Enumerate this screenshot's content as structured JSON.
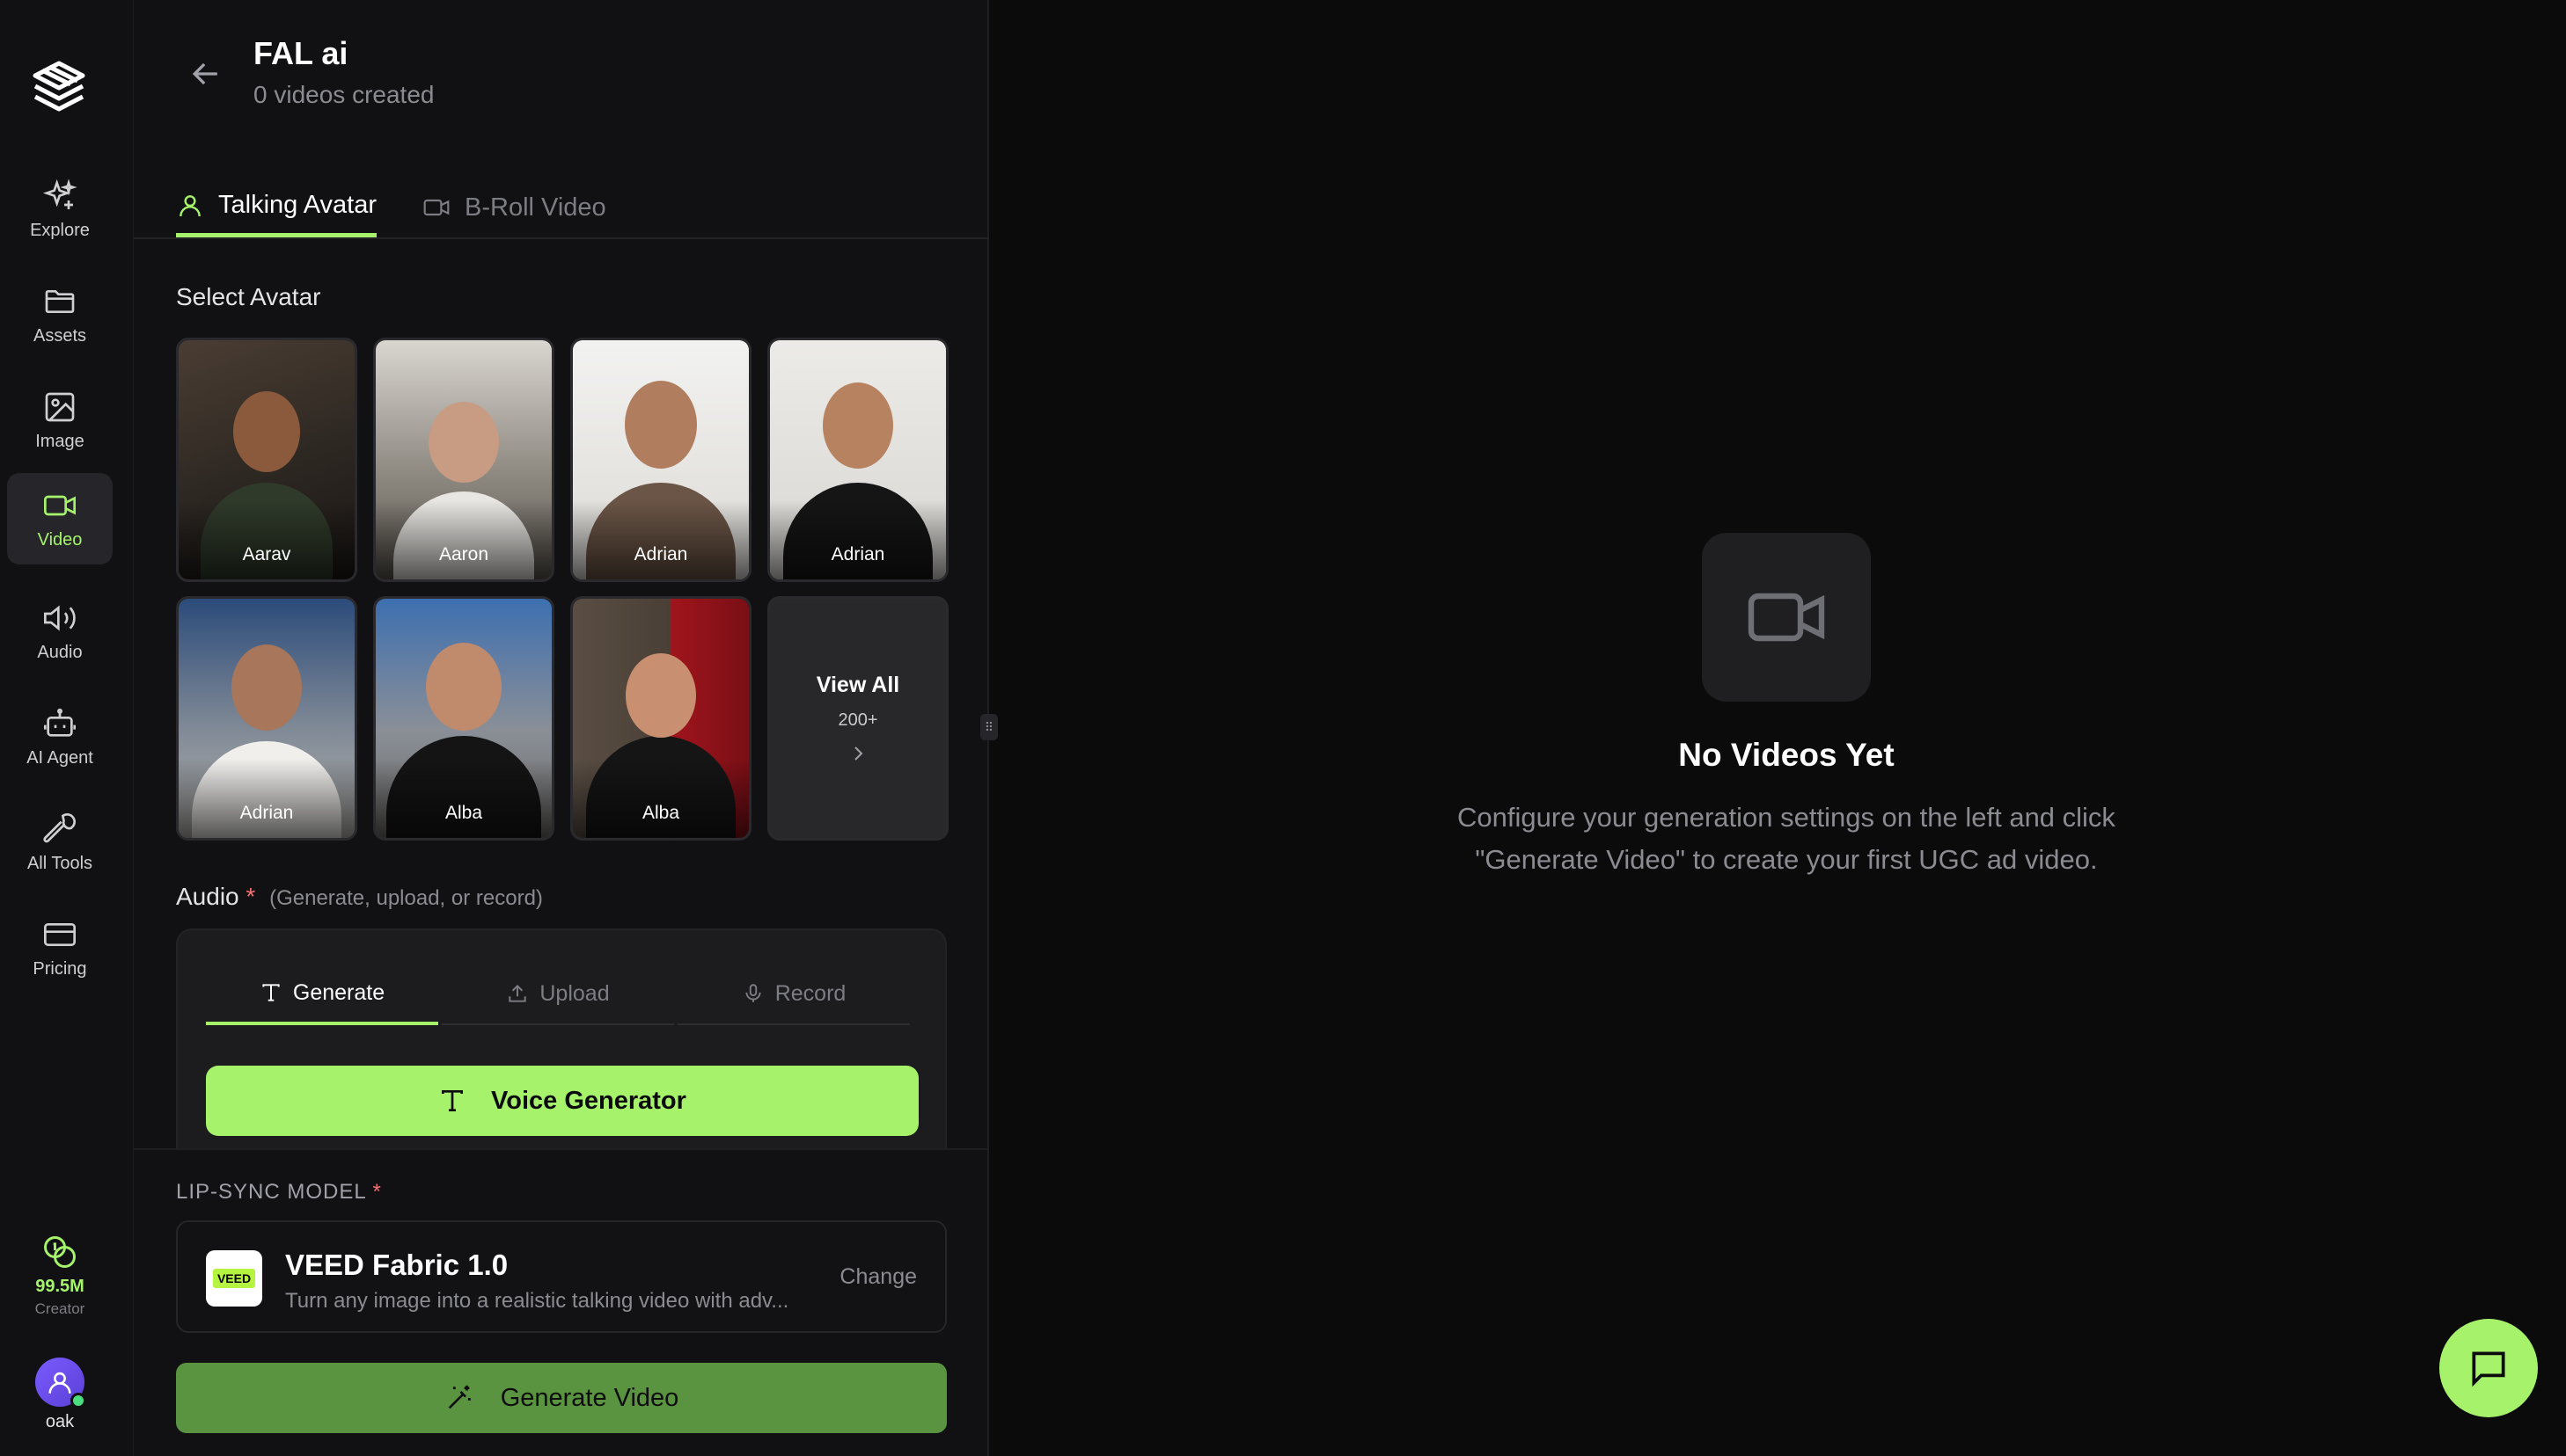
{
  "nav": {
    "items": [
      {
        "label": "Explore",
        "icon": "sparkles-icon"
      },
      {
        "label": "Assets",
        "icon": "folder-icon"
      },
      {
        "label": "Image",
        "icon": "image-icon"
      },
      {
        "label": "Video",
        "icon": "video-icon",
        "active": true
      },
      {
        "label": "Audio",
        "icon": "speaker-icon"
      },
      {
        "label": "AI Agent",
        "icon": "robot-icon"
      },
      {
        "label": "All Tools",
        "icon": "wrench-icon"
      },
      {
        "label": "Pricing",
        "icon": "credit-card-icon"
      }
    ],
    "credits": {
      "amount": "99.5M",
      "tier": "Creator"
    },
    "user": {
      "name": "oak"
    }
  },
  "project": {
    "title": "FAL ai",
    "subtitle": "0 videos created"
  },
  "tabs": {
    "talking_avatar": "Talking Avatar",
    "broll": "B-Roll Video"
  },
  "avatars": {
    "label": "Select Avatar",
    "items": [
      {
        "name": "Aarav"
      },
      {
        "name": "Aaron"
      },
      {
        "name": "Adrian"
      },
      {
        "name": "Adrian"
      },
      {
        "name": "Adrian"
      },
      {
        "name": "Alba"
      },
      {
        "name": "Alba"
      }
    ],
    "view_all": "View All",
    "view_all_count": "200+"
  },
  "audio": {
    "label": "Audio",
    "required_mark": "*",
    "hint": "(Generate, upload, or record)",
    "tabs": {
      "generate": "Generate",
      "upload": "Upload",
      "record": "Record"
    },
    "voice_button": "Voice Generator"
  },
  "lipsync": {
    "label": "LIP-SYNC MODEL",
    "required_mark": "*",
    "logo_text": "VEED",
    "model_name": "VEED Fabric 1.0",
    "model_desc": "Turn any image into a realistic talking video with adv...",
    "change": "Change"
  },
  "generate_button": "Generate Video",
  "empty_state": {
    "title": "No Videos Yet",
    "description": "Configure your generation settings on the left and click \"Generate Video\" to create your first UGC ad video."
  },
  "colors": {
    "accent": "#a6f36b",
    "generate_button": "#5a9440",
    "background": "#0b0b0c",
    "panel": "#111113",
    "required": "#f87171"
  }
}
